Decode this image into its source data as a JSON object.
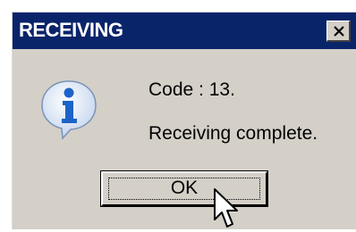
{
  "window": {
    "title": "RECEIVING",
    "close_icon": "close-icon"
  },
  "message": {
    "icon": "info-icon",
    "code_line": "Code : 13.",
    "body_line": "Receiving complete."
  },
  "buttons": {
    "ok_label": "OK"
  },
  "pointer": {
    "icon": "mouse-pointer-icon"
  },
  "colors": {
    "titlebar": "#0a246a",
    "dialog_bg": "#d4d0c8",
    "icon_blue": "#1d63c8"
  }
}
